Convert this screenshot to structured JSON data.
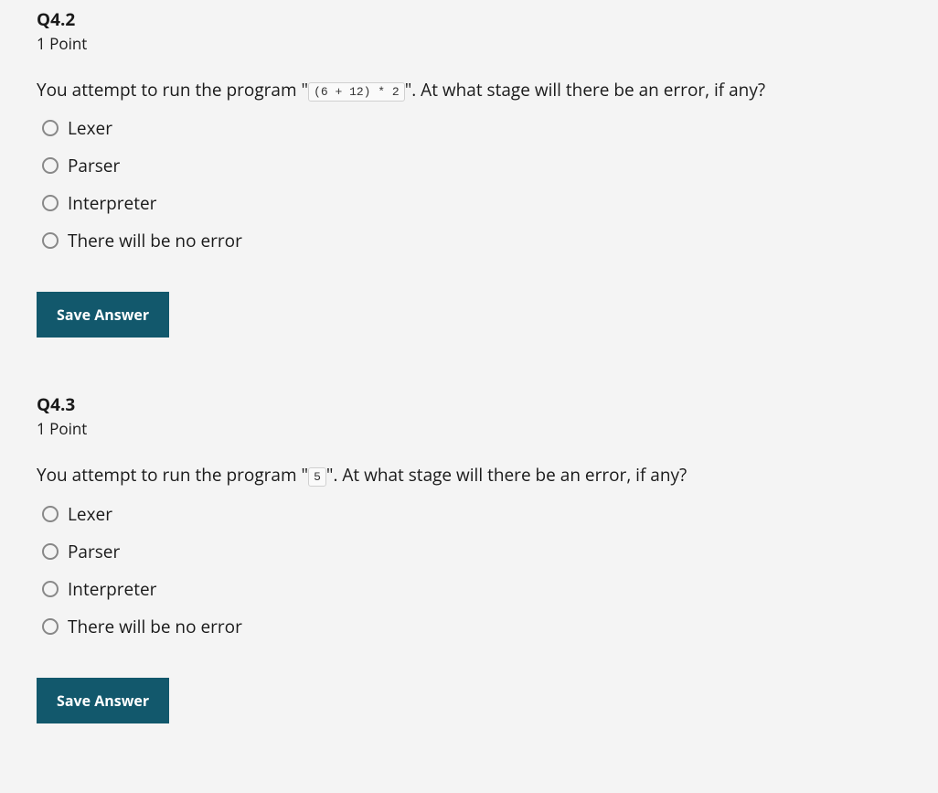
{
  "questions": [
    {
      "number": "Q4.2",
      "points": "1 Point",
      "prompt_prefix": "You attempt to run the program \"",
      "code": "(6 + 12) * 2",
      "prompt_suffix": "\". At what stage will there be an error, if any?",
      "options": [
        "Lexer",
        "Parser",
        "Interpreter",
        "There will be no error"
      ],
      "save_label": "Save Answer"
    },
    {
      "number": "Q4.3",
      "points": "1 Point",
      "prompt_prefix": "You attempt to run the program \"",
      "code": "5",
      "prompt_suffix": "\". At what stage will there be an error, if any?",
      "options": [
        "Lexer",
        "Parser",
        "Interpreter",
        "There will be no error"
      ],
      "save_label": "Save Answer"
    }
  ]
}
